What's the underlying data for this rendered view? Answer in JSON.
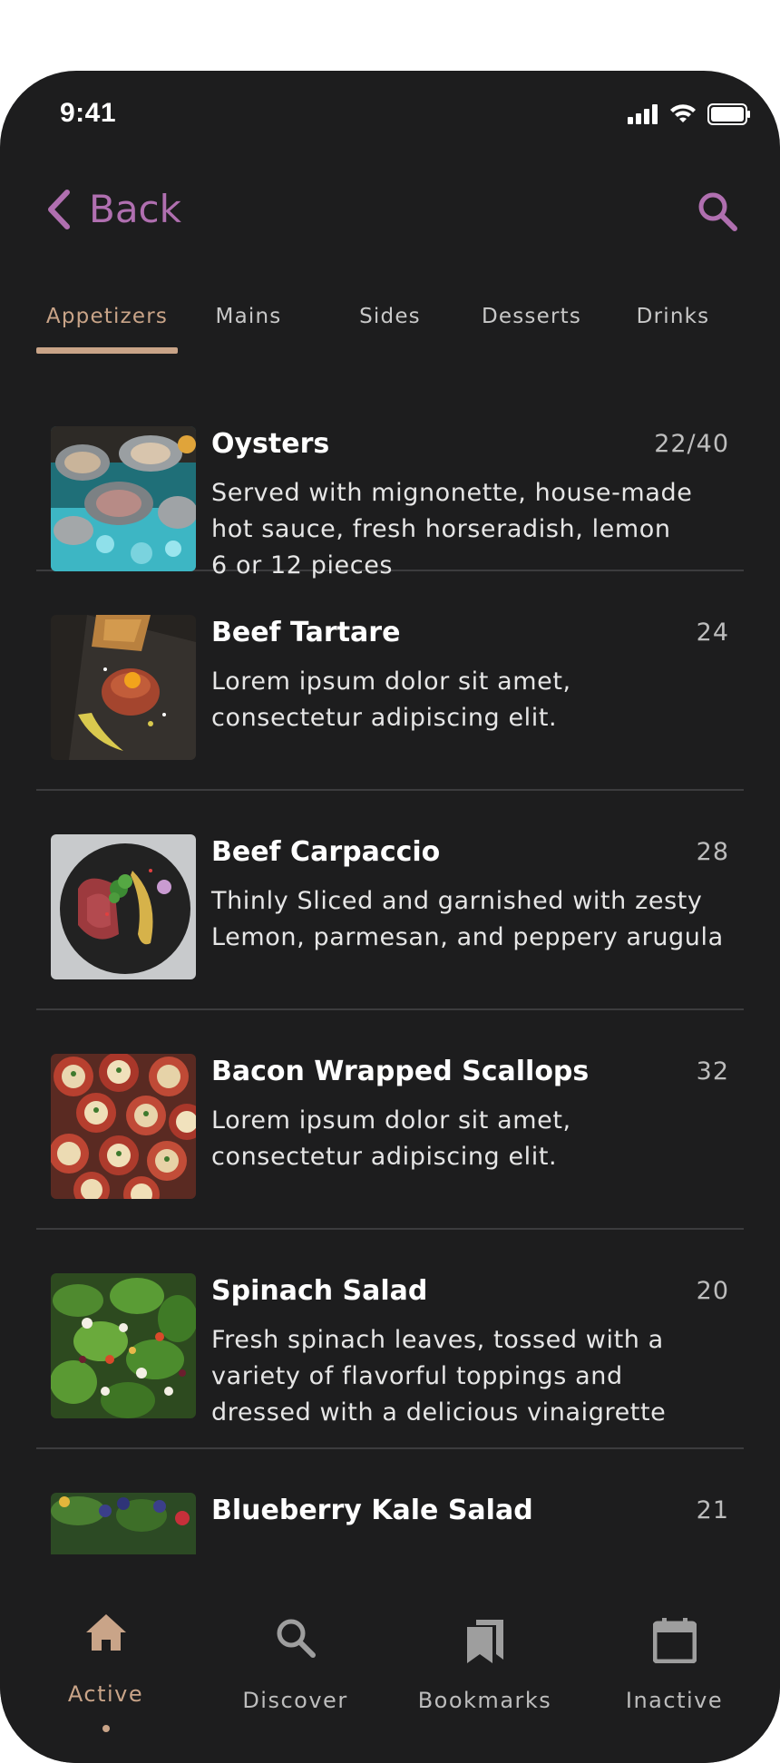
{
  "status_bar": {
    "time": "9:41"
  },
  "header": {
    "back_label": "Back",
    "accent_color": "#b06fb0"
  },
  "tabs": [
    {
      "label": "Appetizers",
      "active": true
    },
    {
      "label": "Mains",
      "active": false
    },
    {
      "label": "Sides",
      "active": false
    },
    {
      "label": "Desserts",
      "active": false
    },
    {
      "label": "Drinks",
      "active": false
    }
  ],
  "menu": {
    "items": [
      {
        "name": "Oysters",
        "price": "22/40",
        "description": [
          "Served with mignonette, house-made",
          "hot sauce, fresh horseradish, lemon",
          "6 or 12 pieces"
        ],
        "image_icon": "oysters-image"
      },
      {
        "name": "Beef Tartare",
        "price": "24",
        "description": [
          "Lorem ipsum dolor sit amet,",
          "consectetur adipiscing elit."
        ],
        "image_icon": "beef-tartare-image"
      },
      {
        "name": "Beef Carpaccio",
        "price": "28",
        "description": [
          "Thinly Sliced and garnished with zesty",
          "Lemon, parmesan, and peppery arugula"
        ],
        "image_icon": "beef-carpaccio-image"
      },
      {
        "name": "Bacon Wrapped Scallops",
        "price": "32",
        "description": [
          "Lorem ipsum dolor sit amet,",
          "consectetur adipiscing elit."
        ],
        "image_icon": "bacon-scallops-image"
      },
      {
        "name": "Spinach Salad",
        "price": "20",
        "description": [
          "Fresh spinach leaves, tossed with a",
          "variety of flavorful toppings and",
          "dressed with a delicious vinaigrette"
        ],
        "image_icon": "spinach-salad-image"
      },
      {
        "name": "Blueberry Kale Salad",
        "price": "21",
        "description": [],
        "image_icon": "kale-salad-image"
      }
    ]
  },
  "bottom_nav": [
    {
      "label": "Active",
      "icon": "home-icon",
      "active": true
    },
    {
      "label": "Discover",
      "icon": "search-icon",
      "active": false
    },
    {
      "label": "Bookmarks",
      "icon": "bookmarks-icon",
      "active": false
    },
    {
      "label": "Inactive",
      "icon": "calendar-icon",
      "active": false
    }
  ],
  "colors": {
    "background": "#1d1d1e",
    "active_tab": "#c9a488",
    "divider": "#3c3c3e"
  }
}
